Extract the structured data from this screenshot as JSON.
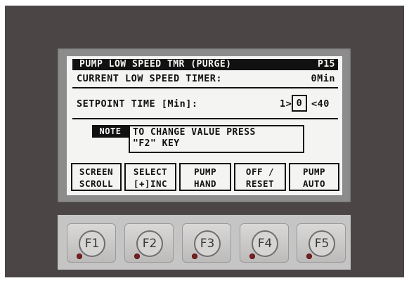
{
  "screen": {
    "title": "PUMP LOW SPEED TMR (PURGE)",
    "page": "P15",
    "current_label": "CURRENT LOW SPEED TIMER:",
    "current_value": "0Min",
    "setpoint_label": "SETPOINT TIME [Min]:",
    "setpoint_min": "1>",
    "setpoint_value": "0",
    "setpoint_max": "<40",
    "note_tag": "NOTE",
    "note_text": "TO CHANGE VALUE PRESS\n\"F2\" KEY"
  },
  "softkeys": [
    {
      "label": "SCREEN\nSCROLL"
    },
    {
      "label": "SELECT\n[+]INC"
    },
    {
      "label": "PUMP\nHAND"
    },
    {
      "label": "OFF /\nRESET"
    },
    {
      "label": "PUMP\nAUTO"
    }
  ],
  "function_keys": [
    {
      "label": "F1"
    },
    {
      "label": "F2"
    },
    {
      "label": "F3"
    },
    {
      "label": "F4"
    },
    {
      "label": "F5"
    }
  ],
  "colors": {
    "housing": "#4b4546",
    "bezel": "#8d8c8c",
    "lcd_background": "#f4f4f2",
    "lcd_ink": "#111111",
    "led": "#7a2222"
  }
}
